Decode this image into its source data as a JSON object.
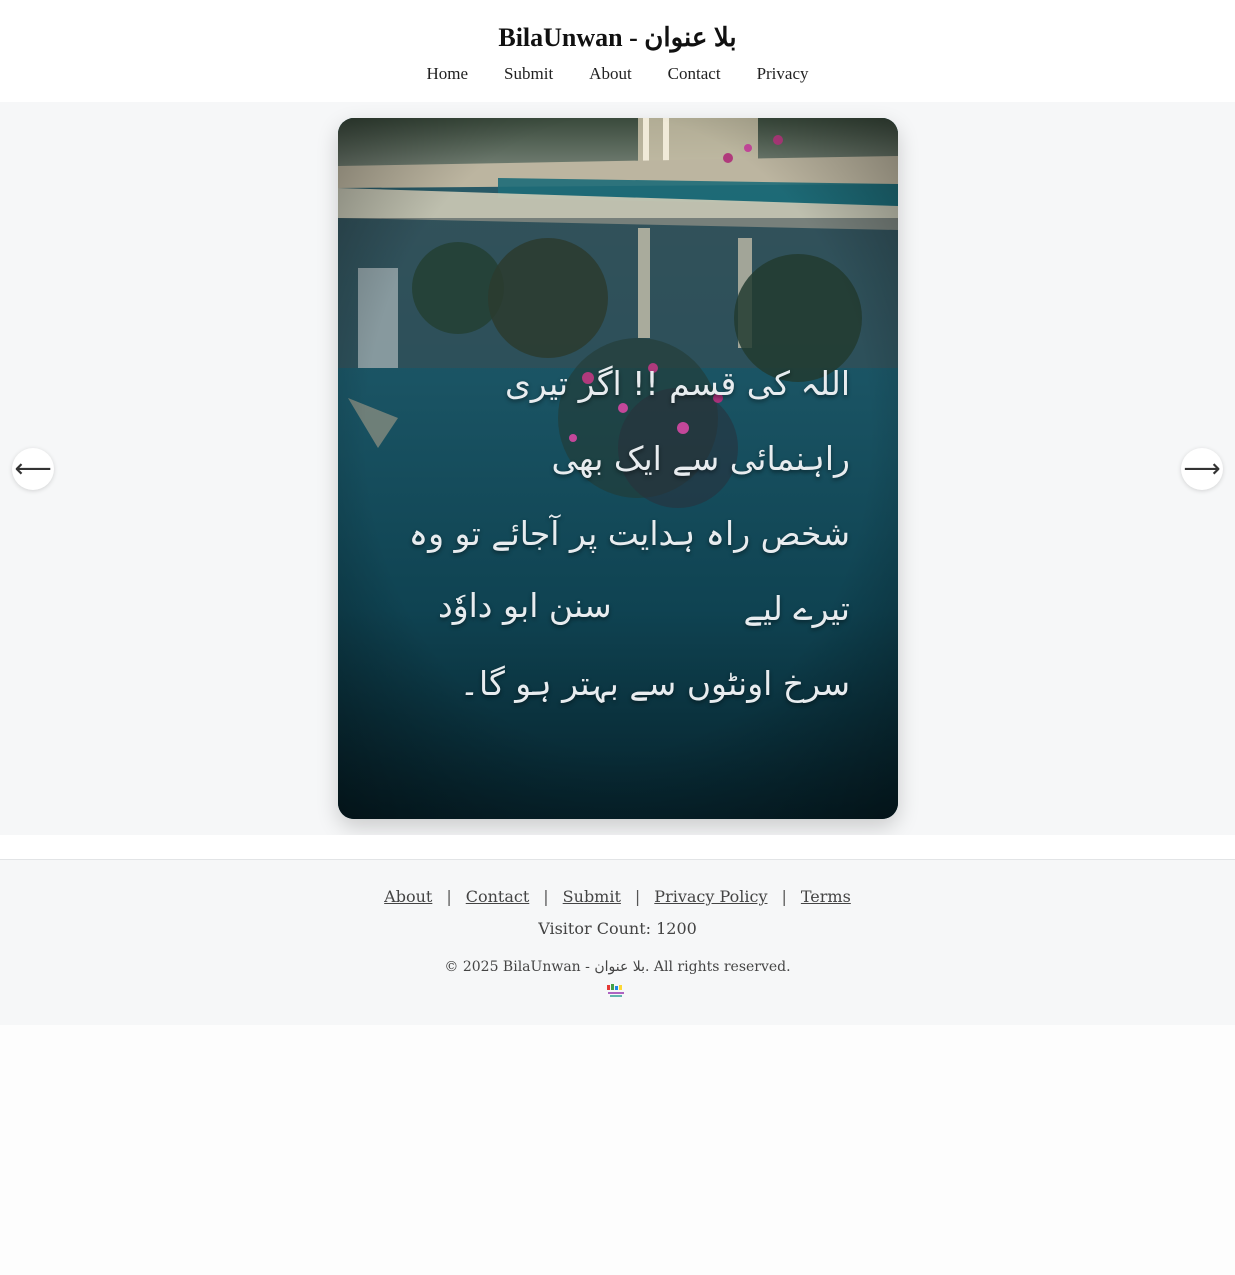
{
  "header": {
    "title": "BilaUnwan - بلا عنوان",
    "nav": [
      "Home",
      "Submit",
      "About",
      "Contact",
      "Privacy"
    ]
  },
  "slide": {
    "quote_lines": [
      "اللہ کی قسم !! اگر تیری راہنمائی سے ایک بھی",
      "شخص راہ ہدایت پر آجائے تو وہ تیرے لیے",
      "سرخ اونٹوں سے بہتر ہو گا۔"
    ],
    "source": "سنن ابو داوٗد",
    "prev_icon": "arrow-left-icon",
    "next_icon": "arrow-right-icon",
    "prev_glyph": "⟵",
    "next_glyph": "⟶"
  },
  "footer": {
    "links": [
      "About",
      "Contact",
      "Submit",
      "Privacy Policy",
      "Terms"
    ],
    "separator": "|",
    "visitor_count": "Visitor Count: 1200",
    "copyright": "© 2025 BilaUnwan - بلا عنوان. All rights reserved."
  },
  "colors": {
    "page_bg": "#fdfdfd",
    "stage_bg": "#f6f7f8",
    "water_teal": "#0d3f4c",
    "quote_text": "#e8ecef"
  }
}
